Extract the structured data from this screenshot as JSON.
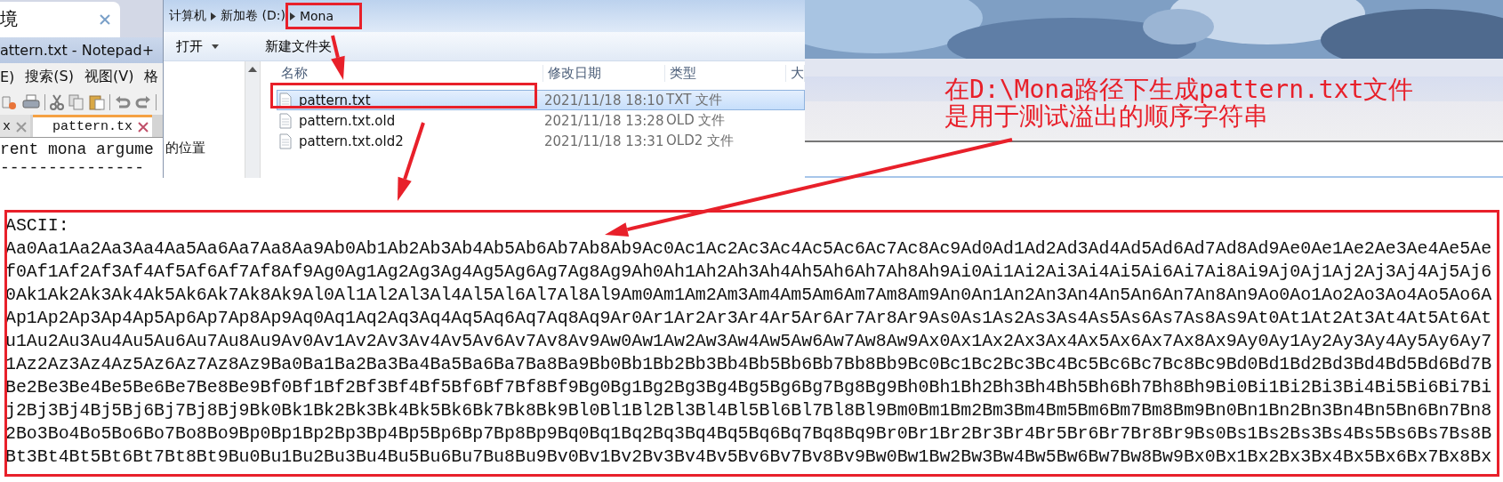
{
  "browser_tab": {
    "label": "境"
  },
  "notepad": {
    "title": "attern.txt - Notepad+",
    "menu": [
      "E)",
      "搜索(S)",
      "视图(V)",
      "格"
    ],
    "tabs": [
      {
        "label": "x",
        "selected": false
      },
      {
        "label": "pattern.tx",
        "selected": true
      }
    ],
    "lines": [
      "rent mona argume",
      "---------------"
    ]
  },
  "explorer": {
    "breadcrumb": [
      "计算机",
      "新加卷 (D:)",
      "Mona"
    ],
    "toolbar": [
      {
        "label": "打开",
        "dropdown": true
      },
      {
        "label": "新建文件夹",
        "dropdown": false
      }
    ],
    "nav_item": "的位置",
    "columns": [
      "名称",
      "修改日期",
      "类型",
      "大"
    ],
    "files": [
      {
        "name": "pattern.txt",
        "modified": "2021/11/18 18:10",
        "type": "TXT 文件",
        "selected": true
      },
      {
        "name": "pattern.txt.old",
        "modified": "2021/11/18 13:28",
        "type": "OLD 文件",
        "selected": false
      },
      {
        "name": "pattern.txt.old2",
        "modified": "2021/11/18 13:31",
        "type": "OLD2 文件",
        "selected": false
      }
    ]
  },
  "annotation": {
    "lines": [
      "在D:\\Mona路径下生成pattern.txt文件",
      "是用于测试溢出的顺序字符串"
    ]
  },
  "output": {
    "heading": "ASCII:",
    "lines": [
      "Aa0Aa1Aa2Aa3Aa4Aa5Aa6Aa7Aa8Aa9Ab0Ab1Ab2Ab3Ab4Ab5Ab6Ab7Ab8Ab9Ac0Ac1Ac2Ac3Ac4Ac5Ac6Ac7Ac8Ac9Ad0Ad1Ad2Ad3Ad4Ad5Ad6Ad7Ad8Ad9Ae0Ae1Ae2Ae3Ae4Ae5Ae",
      "f0Af1Af2Af3Af4Af5Af6Af7Af8Af9Ag0Ag1Ag2Ag3Ag4Ag5Ag6Ag7Ag8Ag9Ah0Ah1Ah2Ah3Ah4Ah5Ah6Ah7Ah8Ah9Ai0Ai1Ai2Ai3Ai4Ai5Ai6Ai7Ai8Ai9Aj0Aj1Aj2Aj3Aj4Aj5Aj6",
      "0Ak1Ak2Ak3Ak4Ak5Ak6Ak7Ak8Ak9Al0Al1Al2Al3Al4Al5Al6Al7Al8Al9Am0Am1Am2Am3Am4Am5Am6Am7Am8Am9An0An1An2An3An4An5An6An7An8An9Ao0Ao1Ao2Ao3Ao4Ao5Ao6A",
      "Ap1Ap2Ap3Ap4Ap5Ap6Ap7Ap8Ap9Aq0Aq1Aq2Aq3Aq4Aq5Aq6Aq7Aq8Aq9Ar0Ar1Ar2Ar3Ar4Ar5Ar6Ar7Ar8Ar9As0As1As2As3As4As5As6As7As8As9At0At1At2At3At4At5At6At",
      "u1Au2Au3Au4Au5Au6Au7Au8Au9Av0Av1Av2Av3Av4Av5Av6Av7Av8Av9Aw0Aw1Aw2Aw3Aw4Aw5Aw6Aw7Aw8Aw9Ax0Ax1Ax2Ax3Ax4Ax5Ax6Ax7Ax8Ax9Ay0Ay1Ay2Ay3Ay4Ay5Ay6Ay7",
      "1Az2Az3Az4Az5Az6Az7Az8Az9Ba0Ba1Ba2Ba3Ba4Ba5Ba6Ba7Ba8Ba9Bb0Bb1Bb2Bb3Bb4Bb5Bb6Bb7Bb8Bb9Bc0Bc1Bc2Bc3Bc4Bc5Bc6Bc7Bc8Bc9Bd0Bd1Bd2Bd3Bd4Bd5Bd6Bd7B",
      "Be2Be3Be4Be5Be6Be7Be8Be9Bf0Bf1Bf2Bf3Bf4Bf5Bf6Bf7Bf8Bf9Bg0Bg1Bg2Bg3Bg4Bg5Bg6Bg7Bg8Bg9Bh0Bh1Bh2Bh3Bh4Bh5Bh6Bh7Bh8Bh9Bi0Bi1Bi2Bi3Bi4Bi5Bi6Bi7Bi",
      "j2Bj3Bj4Bj5Bj6Bj7Bj8Bj9Bk0Bk1Bk2Bk3Bk4Bk5Bk6Bk7Bk8Bk9Bl0Bl1Bl2Bl3Bl4Bl5Bl6Bl7Bl8Bl9Bm0Bm1Bm2Bm3Bm4Bm5Bm6Bm7Bm8Bm9Bn0Bn1Bn2Bn3Bn4Bn5Bn6Bn7Bn8",
      "2Bo3Bo4Bo5Bo6Bo7Bo8Bo9Bp0Bp1Bp2Bp3Bp4Bp5Bp6Bp7Bp8Bp9Bq0Bq1Bq2Bq3Bq4Bq5Bq6Bq7Bq8Bq9Br0Br1Br2Br3Br4Br5Br6Br7Br8Br9Bs0Bs1Bs2Bs3Bs4Bs5Bs6Bs7Bs8B",
      "Bt3Bt4Bt5Bt6Bt7Bt8Bt9Bu0Bu1Bu2Bu3Bu4Bu5Bu6Bu7Bu8Bu9Bv0Bv1Bv2Bv3Bv4Bv5Bv6Bv7Bv8Bv9Bw0Bw1Bw2Bw3Bw4Bw5Bw6Bw7Bw8Bw9Bx0Bx1Bx2Bx3Bx4Bx5Bx6Bx7Bx8Bx"
    ]
  }
}
